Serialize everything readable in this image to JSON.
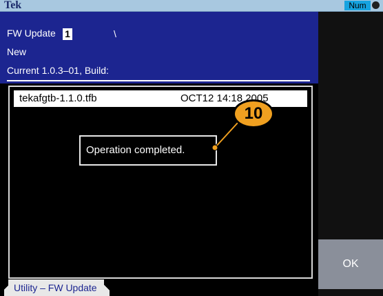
{
  "status_bar": {
    "brand": "Tek",
    "num_indicator": "Num",
    "globe_icon": "globe-icon"
  },
  "header": {
    "title": "FW Update",
    "cursor_value": "1",
    "separator": "\\",
    "new_label": "New",
    "current_label": "Current  1.0.3–01, Build:"
  },
  "file_list": [
    {
      "name": "tekafgtb-1.1.0.tfb",
      "date": "OCT12 14:18 2005"
    }
  ],
  "dialog": {
    "message": "Operation completed."
  },
  "callout": {
    "number": "10"
  },
  "softkeys": {
    "ok_label": "OK"
  },
  "menu_tab": {
    "label": "Utility – FW Update"
  },
  "colors": {
    "header_bg": "#1c2590",
    "top_bar": "#a8c8e0",
    "num_badge": "#16a3e0",
    "callout": "#f0a020"
  }
}
